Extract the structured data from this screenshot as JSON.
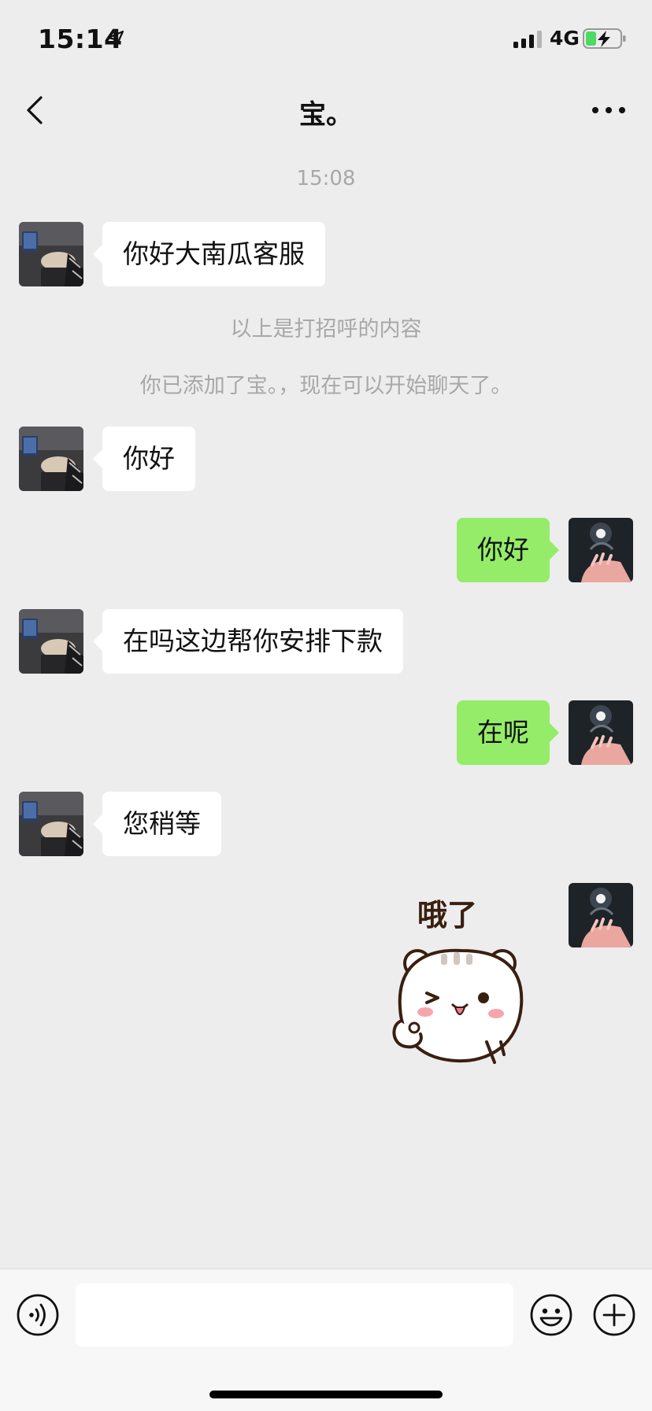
{
  "status_bar": {
    "time": "15:14",
    "network": "4G"
  },
  "header": {
    "title": "宝。"
  },
  "chat": {
    "timestamp": "15:08",
    "system_messages": [
      "以上是打招呼的内容",
      "你已添加了宝。，现在可以开始聊天了。"
    ],
    "messages": [
      {
        "sender": "other",
        "text": "你好大南瓜客服"
      },
      {
        "sender": "other",
        "text": "你好"
      },
      {
        "sender": "me",
        "text": "你好"
      },
      {
        "sender": "other",
        "text": "在吗这边帮你安排下款"
      },
      {
        "sender": "me",
        "text": "在呢"
      },
      {
        "sender": "other",
        "text": "您稍等"
      },
      {
        "sender": "me",
        "type": "sticker",
        "text": "哦了"
      }
    ]
  },
  "input": {
    "value": "",
    "placeholder": ""
  },
  "icons": {
    "back": "chevron-left-icon",
    "more": "more-dots-icon",
    "voice": "voice-icon",
    "emoji": "emoji-icon",
    "plus": "plus-icon"
  },
  "colors": {
    "background": "#ededed",
    "outgoing_bubble": "#95ec69",
    "incoming_bubble": "#ffffff",
    "system_text": "#a8a8a8",
    "battery_charge": "#4cd964"
  }
}
